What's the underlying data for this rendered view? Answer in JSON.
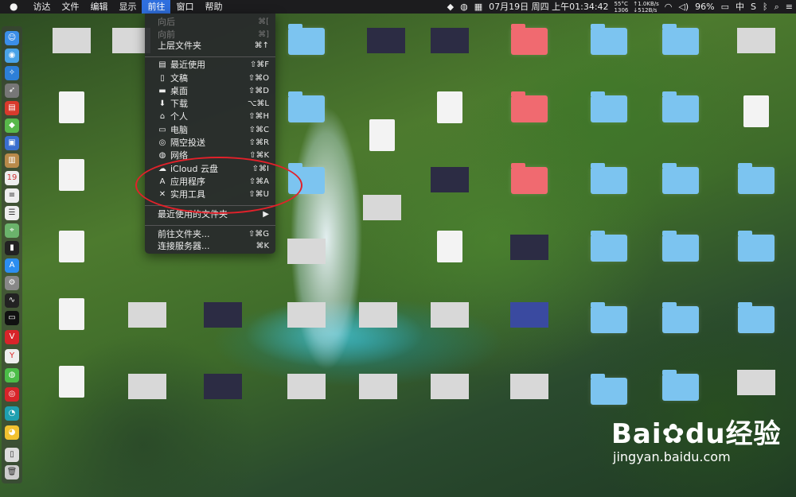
{
  "menubar": {
    "items": [
      "访达",
      "文件",
      "编辑",
      "显示",
      "前往",
      "窗口",
      "帮助"
    ],
    "active_index": 4,
    "status": {
      "temp": "55°C",
      "fan": "1306",
      "net_up": "↑1.0KB/s",
      "net_down": "↓512B/s",
      "datetime": "07月19日 周四 上午01:34:42",
      "battery": "96%",
      "input": "中"
    }
  },
  "go_menu": {
    "items": [
      {
        "label": "向后",
        "shortcut": "⌘[",
        "icon": "",
        "disabled": true
      },
      {
        "label": "向前",
        "shortcut": "⌘]",
        "icon": "",
        "disabled": true
      },
      {
        "label": "上层文件夹",
        "shortcut": "⌘↑",
        "icon": "",
        "disabled": false
      },
      {
        "label": "最近使用",
        "shortcut": "⇧⌘F",
        "icon": "recents-icon",
        "disabled": false
      },
      {
        "label": "文稿",
        "shortcut": "⇧⌘O",
        "icon": "documents-icon",
        "disabled": false
      },
      {
        "label": "桌面",
        "shortcut": "⇧⌘D",
        "icon": "desktop-icon",
        "disabled": false
      },
      {
        "label": "下载",
        "shortcut": "⌥⌘L",
        "icon": "downloads-icon",
        "disabled": false
      },
      {
        "label": "个人",
        "shortcut": "⇧⌘H",
        "icon": "home-icon",
        "disabled": false
      },
      {
        "label": "电脑",
        "shortcut": "⇧⌘C",
        "icon": "computer-icon",
        "disabled": false
      },
      {
        "label": "隔空投送",
        "shortcut": "⇧⌘R",
        "icon": "airdrop-icon",
        "disabled": false
      },
      {
        "label": "网络",
        "shortcut": "⇧⌘K",
        "icon": "network-icon",
        "disabled": false
      },
      {
        "label": "iCloud 云盘",
        "shortcut": "⇧⌘I",
        "icon": "icloud-icon",
        "disabled": false
      },
      {
        "label": "应用程序",
        "shortcut": "⇧⌘A",
        "icon": "applications-icon",
        "disabled": false
      },
      {
        "label": "实用工具",
        "shortcut": "⇧⌘U",
        "icon": "utilities-icon",
        "disabled": false
      },
      {
        "label": "最近使用的文件夹",
        "shortcut": "▶",
        "icon": "",
        "disabled": false
      },
      {
        "label": "前往文件夹...",
        "shortcut": "⇧⌘G",
        "icon": "",
        "disabled": false
      },
      {
        "label": "连接服务器...",
        "shortcut": "⌘K",
        "icon": "",
        "disabled": false
      }
    ]
  },
  "watermark": {
    "brand": "Bai",
    "brand2": "du",
    "cn": "经验",
    "url": "jingyan.baidu.com"
  },
  "colors": {
    "menubar": "#1c1c1e",
    "highlight": "#2f6fde",
    "annotation": "#e2212a",
    "folder": "#7cc4f0",
    "folder_red": "#f06a70"
  }
}
